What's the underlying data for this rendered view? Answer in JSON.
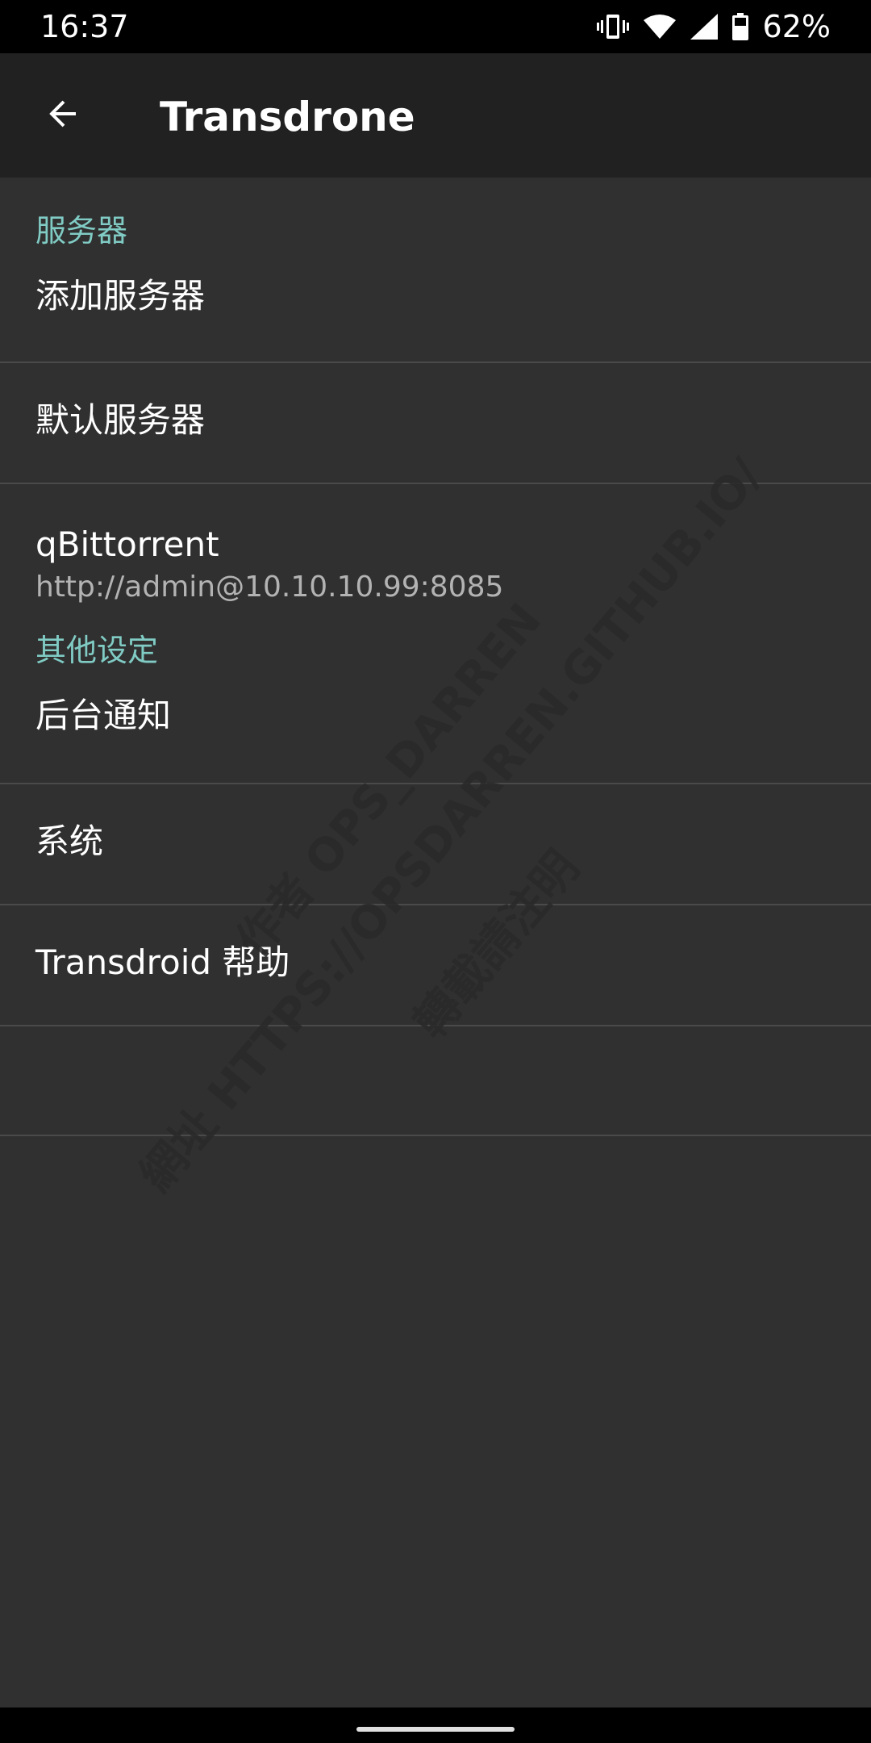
{
  "status_bar": {
    "time": "16:37",
    "battery_percent": "62%",
    "icons": [
      "vibrate-icon",
      "wifi-icon",
      "signal-icon",
      "battery-icon"
    ]
  },
  "toolbar": {
    "back_icon": "arrow-back-icon",
    "title": "Transdrone"
  },
  "colors": {
    "category_accent": "#80cbc4",
    "background": "#303030",
    "toolbar": "#212121"
  },
  "sections": {
    "servers": {
      "header": "服务器",
      "add_server": "添加服务器",
      "default_server": "默认服务器",
      "server_item": {
        "title": "qBittorrent",
        "summary": "http://admin@10.10.10.99:8085"
      }
    },
    "other": {
      "header": "其他设定",
      "background_notifications": "后台通知",
      "system": "系统",
      "help": "Transdroid 帮助"
    }
  },
  "watermark": {
    "line1": "作者 OPS_DARREN",
    "line2": "網址 HTTPS://OPSDARREN.GITHUB.IO/",
    "line3": "轉載請注明"
  }
}
